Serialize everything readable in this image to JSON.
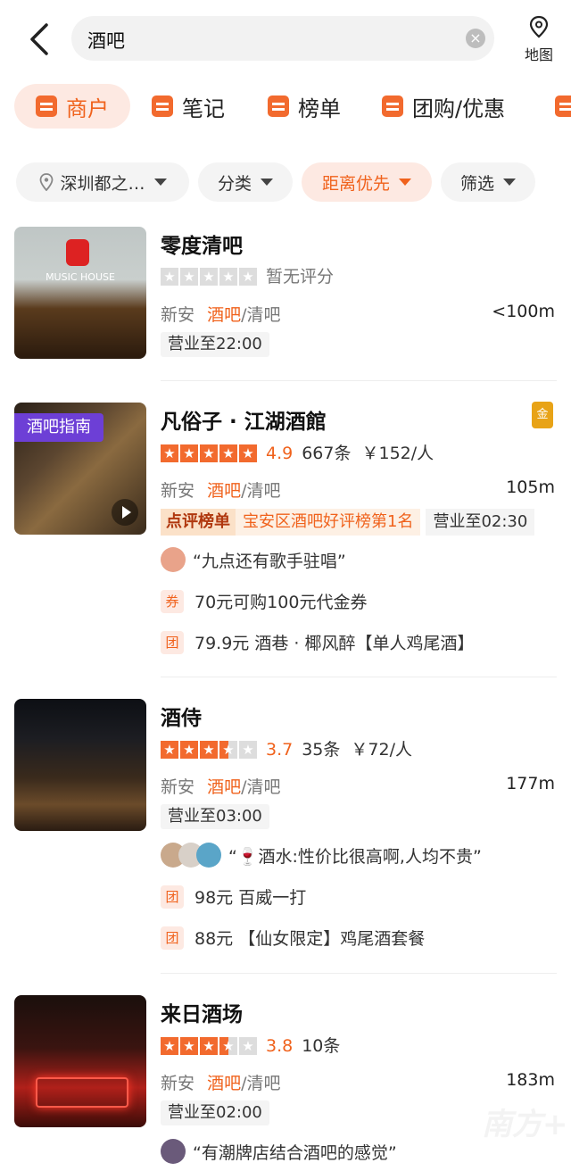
{
  "search": {
    "query": "酒吧",
    "map_label": "地图"
  },
  "tabs": [
    {
      "label": "商户"
    },
    {
      "label": "笔记"
    },
    {
      "label": "榜单"
    },
    {
      "label": "团购/优惠"
    }
  ],
  "filters": [
    {
      "label": "深圳都之…"
    },
    {
      "label": "分类"
    },
    {
      "label": "距离优先"
    },
    {
      "label": "筛选"
    }
  ],
  "shops": [
    {
      "name": "零度清吧",
      "rating_text": "暂无评分",
      "area": "新安",
      "category": "酒吧",
      "subcategory": "/清吧",
      "distance": "<100m",
      "hours": "营业至22:00",
      "stars": 0
    },
    {
      "name": "凡俗子 · 江湖酒館",
      "badge": "酒吧指南",
      "medal": "金",
      "stars": 5,
      "score": "4.9",
      "reviews": "667条",
      "price": "￥152/人",
      "area": "新安",
      "category": "酒吧",
      "subcategory": "/清吧",
      "distance": "105m",
      "rank_tag": "点评榜单",
      "rank_text": "宝安区酒吧好评榜第1名",
      "hours": "营业至02:30",
      "quote": "“九点还有歌手驻唱”",
      "coupons": [
        {
          "icon": "券",
          "text": "70元可购100元代金券"
        },
        {
          "icon": "团",
          "text": "79.9元 酒巷 · 椰风醉【单人鸡尾酒】"
        }
      ]
    },
    {
      "name": "酒侍",
      "stars": 3.5,
      "score": "3.7",
      "reviews": "35条",
      "price": "￥72/人",
      "area": "新安",
      "category": "酒吧",
      "subcategory": "/清吧",
      "distance": "177m",
      "hours": "营业至03:00",
      "quote": "“🍷酒水:性价比很高啊,人均不贵”",
      "coupons": [
        {
          "icon": "团",
          "text": "98元 百威一打"
        },
        {
          "icon": "团",
          "text": "88元 【仙女限定】鸡尾酒套餐"
        }
      ]
    },
    {
      "name": "来日酒场",
      "stars": 3.5,
      "score": "3.8",
      "reviews": "10条",
      "area": "新安",
      "category": "酒吧",
      "subcategory": "/清吧",
      "distance": "183m",
      "hours": "营业至02:00",
      "quote": "“有潮牌店结合酒吧的感觉”"
    }
  ],
  "watermark": "南方+",
  "colors": {
    "accent": "#f0621c",
    "guide_badge": "#6d3fd6"
  }
}
